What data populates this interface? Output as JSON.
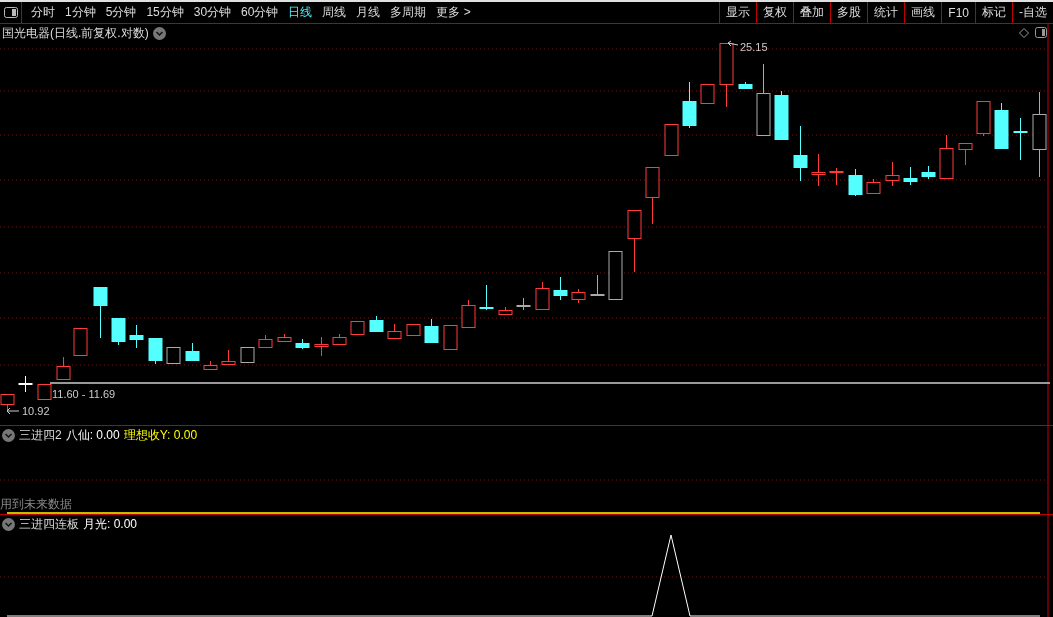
{
  "toolbar": {
    "period_tabs": [
      {
        "label": "分时",
        "selected": false
      },
      {
        "label": "1分钟",
        "selected": false
      },
      {
        "label": "5分钟",
        "selected": false
      },
      {
        "label": "15分钟",
        "selected": false
      },
      {
        "label": "30分钟",
        "selected": false
      },
      {
        "label": "60分钟",
        "selected": false
      },
      {
        "label": "日线",
        "selected": true
      },
      {
        "label": "周线",
        "selected": false
      },
      {
        "label": "月线",
        "selected": false
      },
      {
        "label": "多周期",
        "selected": false
      },
      {
        "label": "更多 >",
        "selected": false
      }
    ],
    "tool_buttons": [
      "显示",
      "复权",
      "叠加",
      "多股",
      "统计",
      "画线",
      "F10",
      "标记",
      "-自选"
    ]
  },
  "main_chart": {
    "title": "国光电器(日线.前复权.对数)",
    "high_label": "25.15",
    "range_label": "11.60 - 11.69",
    "low_label": "10.92"
  },
  "indicator_panels": [
    {
      "name": "三进四2",
      "values": [
        {
          "label": "八仙: 0.00",
          "color": "#ffffff"
        },
        {
          "label": "理想收Y: 0.00",
          "color": "#ffff00"
        }
      ],
      "note": "用到未来数据"
    },
    {
      "name": "三进四连板",
      "values": [
        {
          "label": "月光: 0.00"
        }
      ]
    }
  ]
}
